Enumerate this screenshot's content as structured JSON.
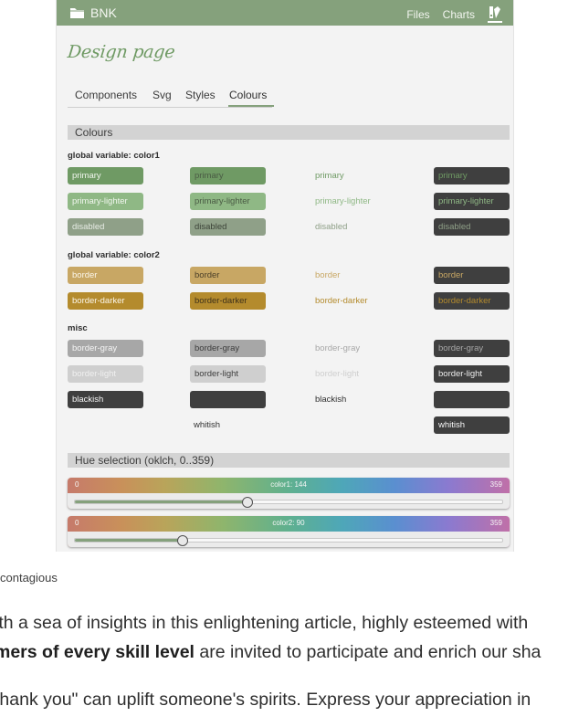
{
  "app": {
    "brand": "BNK",
    "nav": [
      "Files",
      "Charts"
    ],
    "title": "Design page",
    "tabs": [
      {
        "label": "Components"
      },
      {
        "label": "Svg"
      },
      {
        "label": "Styles"
      },
      {
        "label": "Colours",
        "active": true
      }
    ]
  },
  "colours": {
    "section_title": "Colours",
    "groups": [
      {
        "title": "global variable: color1",
        "rows": [
          {
            "label": "primary",
            "bg": "#6f9a64",
            "dim": "#6f9a64",
            "fg_light": "#f1f6ee",
            "fg_dark": "#4a5b44"
          },
          {
            "label": "primary-lighter",
            "bg": "#8fb885",
            "dim": "#8fb885",
            "fg_light": "#f1f6ee",
            "fg_dark": "#4a5b44"
          },
          {
            "label": "disabled",
            "bg": "#8fa088",
            "dim": "#8fa088",
            "fg_light": "#e7ece5",
            "fg_dark": "#3c4338"
          }
        ]
      },
      {
        "title": "global variable: color2",
        "rows": [
          {
            "label": "border",
            "bg": "#c8a764",
            "dim": "#c8a764",
            "fg_light": "#fbf6ea",
            "fg_dark": "#4b3f28"
          },
          {
            "label": "border-darker",
            "bg": "#b48b2d",
            "dim": "#b48b2d",
            "fg_light": "#fbf6ea",
            "fg_dark": "#3f321a"
          }
        ]
      },
      {
        "title": "misc",
        "rows": [
          {
            "label": "border-gray",
            "bg": "#a7a7a7",
            "dim": "#a7a7a7",
            "fg_light": "#f5f5f5",
            "fg_dark": "#3d3d3d"
          },
          {
            "label": "border-light",
            "bg": "#cfcfcf",
            "dim": "#cfcfcf",
            "fg_light": "#f5f5f5",
            "fg_dark": "#3d3d3d"
          },
          {
            "label": "blackish",
            "bg": "#3f3f3f",
            "dim": "#3f3f3f",
            "fg_light": "#f5f5f5",
            "fg_dark": "#303030"
          },
          {
            "label": "whitish",
            "bg": "#f7f7f7",
            "dim": "#f7f7f7",
            "fg_light": "#f5f5f5",
            "fg_dark": "#303030"
          }
        ]
      }
    ]
  },
  "hue": {
    "section_title": "Hue selection (oklch, 0..359)",
    "sliders": [
      {
        "label": "color1: 144",
        "value": 144,
        "min": "0",
        "max": "359"
      },
      {
        "label": "color2: 90",
        "value": 90,
        "min": "0",
        "max": "359"
      }
    ]
  },
  "article": {
    "caption": "contagious",
    "line1": "ith a sea of insights in this enlightening article, highly esteemed with",
    "line2_bold": "mers of every skill level",
    "line2_rest": " are invited to participate and enrich our sha",
    "line3": "thank you\" can uplift someone's spirits. Express your appreciation in"
  },
  "theme": {
    "accent": "#85a17c",
    "dark_chip": "#3f3f3f",
    "section_bg": "#d3d3d3"
  }
}
